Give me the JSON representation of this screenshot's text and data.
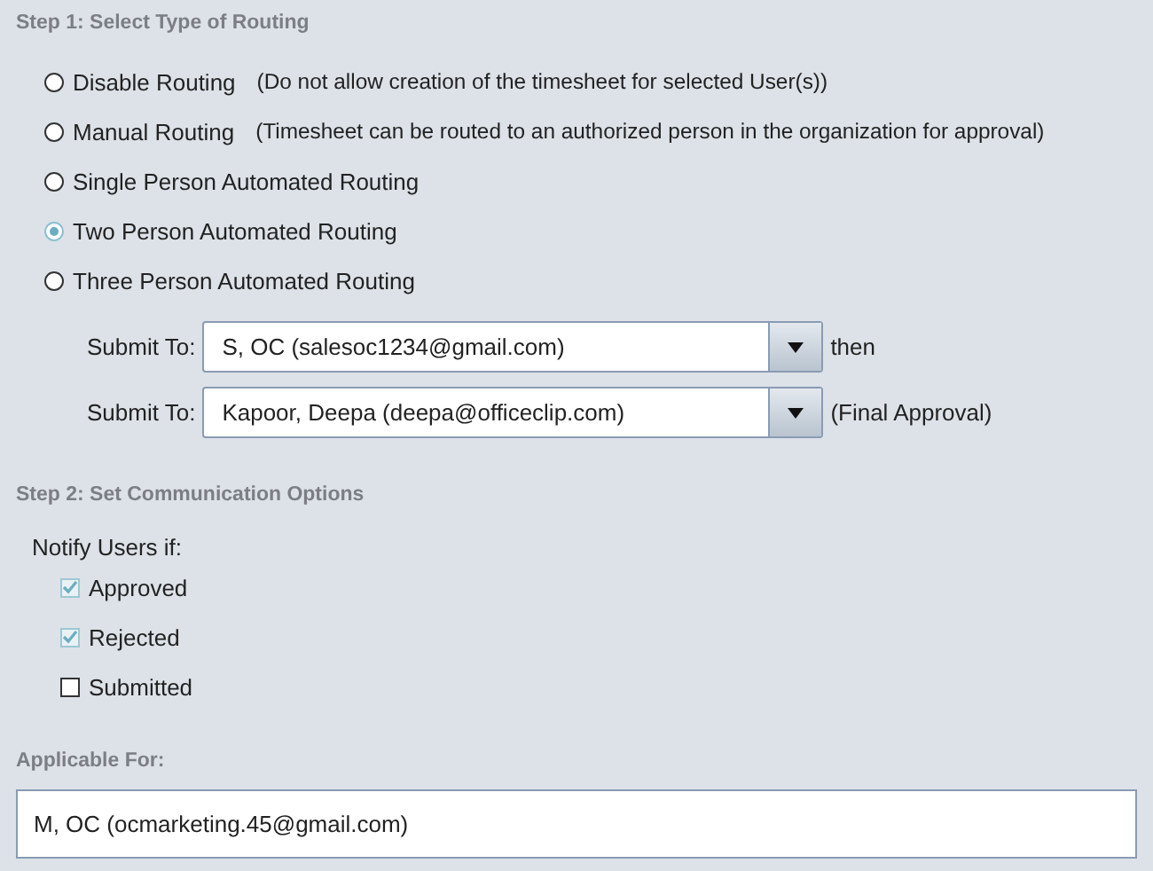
{
  "step1": {
    "title": "Step 1: Select Type of Routing",
    "options": [
      {
        "label": "Disable Routing",
        "description": "(Do not allow creation of the timesheet for selected User(s))",
        "selected": false
      },
      {
        "label": "Manual Routing",
        "description": "(Timesheet can be routed to an authorized person in the organization for approval)",
        "selected": false
      },
      {
        "label": "Single Person Automated Routing",
        "selected": false
      },
      {
        "label": "Two Person Automated Routing",
        "selected": true
      },
      {
        "label": "Three Person Automated Routing",
        "selected": false
      }
    ],
    "submit_rows": [
      {
        "label": "Submit To:",
        "value": "S, OC (salesoc1234@gmail.com)",
        "suffix": "then"
      },
      {
        "label": "Submit To:",
        "value": "Kapoor, Deepa (deepa@officeclip.com)",
        "suffix": "(Final Approval)"
      }
    ]
  },
  "step2": {
    "title": "Step 2: Set Communication Options",
    "notify_label": "Notify Users if:",
    "checkboxes": [
      {
        "label": "Approved",
        "checked": true
      },
      {
        "label": "Rejected",
        "checked": true
      },
      {
        "label": "Submitted",
        "checked": false
      }
    ]
  },
  "applicable_for": {
    "title": "Applicable For:",
    "value": "M, OC (ocmarketing.45@gmail.com)"
  }
}
